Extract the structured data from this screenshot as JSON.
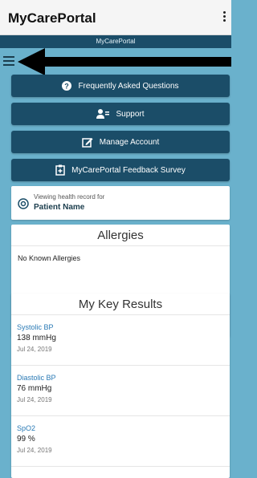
{
  "app": {
    "title": "MyCarePortal",
    "subtitle": "MyCarePortal"
  },
  "icons": {
    "menu": "kebab-menu-icon",
    "hamburger": "hamburger-menu-icon",
    "arrow": "left-arrow-icon"
  },
  "buttons": [
    {
      "label": "Frequently Asked Questions",
      "icon": "question-icon"
    },
    {
      "label": "Support",
      "icon": "support-person-icon"
    },
    {
      "label": "Manage Account",
      "icon": "edit-icon"
    },
    {
      "label": "MyCarePortal Feedback Survey",
      "icon": "survey-icon"
    }
  ],
  "patient": {
    "viewing": "Viewing health record for",
    "name": "Patient Name"
  },
  "allergies": {
    "title": "Allergies",
    "text": "No Known Allergies"
  },
  "results": {
    "title": "My Key Results",
    "items": [
      {
        "name": "Systolic BP",
        "value": "138 mmHg",
        "date": "Jul 24, 2019"
      },
      {
        "name": "Diastolic BP",
        "value": "76 mmHg",
        "date": "Jul 24, 2019"
      },
      {
        "name": "SpO2",
        "value": "99 %",
        "date": "Jul 24, 2019"
      }
    ]
  },
  "colors": {
    "header_dark": "#1b4d68",
    "background": "#6ab1cc",
    "link": "#2a7ab5"
  }
}
